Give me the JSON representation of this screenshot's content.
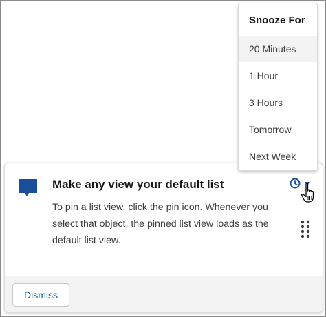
{
  "card": {
    "title": "Make any view your default list",
    "body": "To pin a list view, click the pin icon. Whenever you select that object, the pinned list view loads as the default list view.",
    "icon": "chat-bubble-icon",
    "accent_color": "#1b4f9c"
  },
  "snooze": {
    "header": "Snooze For",
    "options": [
      {
        "label": "20 Minutes",
        "highlighted": true
      },
      {
        "label": "1 Hour",
        "highlighted": false
      },
      {
        "label": "3 Hours",
        "highlighted": false
      },
      {
        "label": "Tomorrow",
        "highlighted": false
      },
      {
        "label": "Next Week",
        "highlighted": false
      }
    ],
    "trigger_icon": "clock-icon"
  },
  "footer": {
    "dismiss_label": "Dismiss"
  },
  "colors": {
    "link_blue": "#0b5cab",
    "icon_blue": "#1b4f9c",
    "hover_gray": "#f3f3f3"
  }
}
